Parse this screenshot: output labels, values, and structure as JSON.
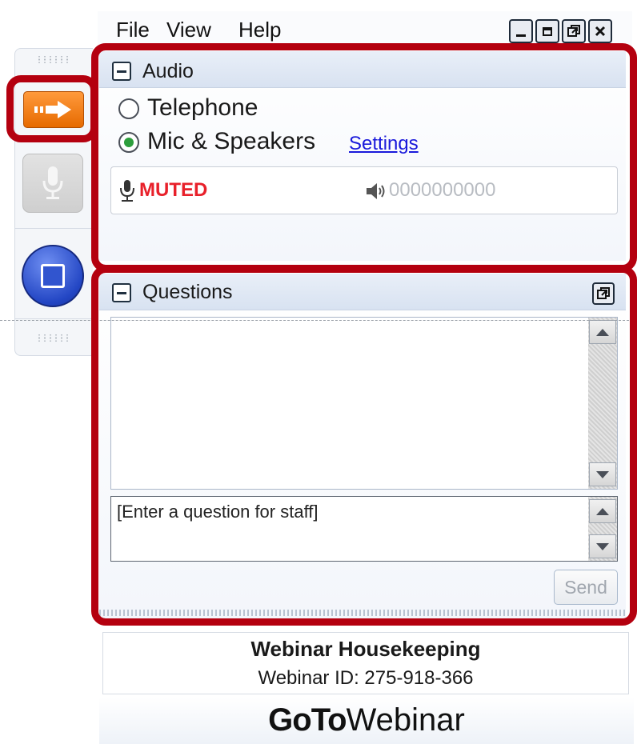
{
  "menu": {
    "file": "File",
    "view": "View",
    "help": "Help"
  },
  "window_controls": [
    "minimize-icon",
    "maximize-icon",
    "restore-icon",
    "close-icon"
  ],
  "toolbar": {
    "grip_dots": "::::::",
    "icons": [
      "arrow-right-icon",
      "microphone-icon",
      "stop-icon"
    ]
  },
  "audio": {
    "title": "Audio",
    "options": [
      {
        "label": "Telephone",
        "selected": false
      },
      {
        "label": "Mic & Speakers",
        "selected": true
      }
    ],
    "settings_link": "Settings",
    "status": "MUTED",
    "level_meter": "0000000000"
  },
  "questions": {
    "title": "Questions",
    "input_placeholder": "[Enter a question for staff]",
    "send_label": "Send"
  },
  "footer": {
    "title": "Webinar Housekeeping",
    "webinar_id": "Webinar ID: 275-918-366",
    "brand_bold": "GoTo",
    "brand_light": "Webinar"
  },
  "colors": {
    "highlight": "#b4000f",
    "muted_text": "#e8202a",
    "settings_link": "#1a1adb",
    "selected_radio": "#2d9e3c",
    "arrow_button": "#ef7a12",
    "stop_button": "#2a4cc8"
  }
}
